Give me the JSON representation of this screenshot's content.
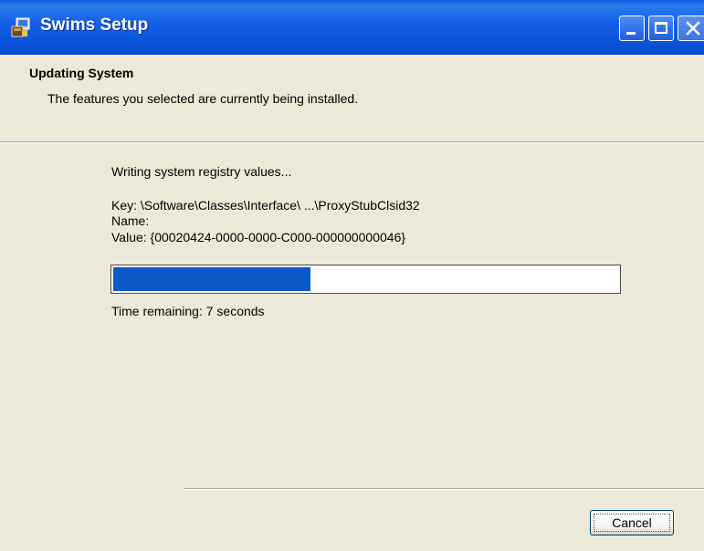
{
  "window": {
    "title": "Swims Setup",
    "icon": "installer-icon"
  },
  "header": {
    "title": "Updating System",
    "description": "The features you selected are currently being installed."
  },
  "main": {
    "status": "Writing system registry values...",
    "registry": {
      "key": "Key: \\Software\\Classes\\Interface\\ ...\\ProxyStubClsid32",
      "name": "Name:",
      "value": "Value: {00020424-0000-0000-C000-000000000046}"
    },
    "progress_fraction": 0.39,
    "time_remaining": "Time remaining: 7 seconds"
  },
  "footer": {
    "cancel_label": "Cancel"
  },
  "colors": {
    "titlebar": "#0b55dc",
    "progress_fill": "#0b58c8",
    "background": "#ece9d8"
  }
}
